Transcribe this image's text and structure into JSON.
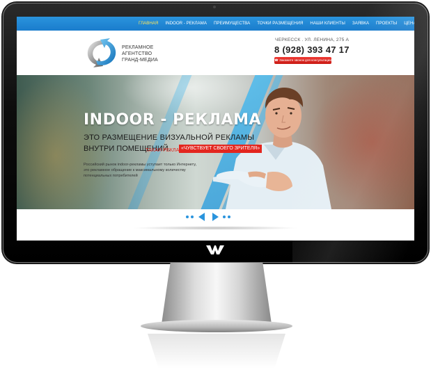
{
  "nav": {
    "items": [
      {
        "label": "ГЛАВНАЯ",
        "active": true
      },
      {
        "label": "INDOOR - РЕКЛАМА",
        "active": false
      },
      {
        "label": "ПРЕИМУЩЕСТВА",
        "active": false
      },
      {
        "label": "ТОЧКИ РАЗМЕЩЕНИЯ",
        "active": false
      },
      {
        "label": "НАШИ КЛИЕНТЫ",
        "active": false
      },
      {
        "label": "ЗАЯВКА",
        "active": false
      },
      {
        "label": "ПРОЕКТЫ",
        "active": false
      },
      {
        "label": "ЦЕНА",
        "active": false
      }
    ]
  },
  "header": {
    "logo_lines": [
      "РЕКЛАМНОЕ",
      "АГЕНТСТВО",
      "ГРАНД-МЕДИА"
    ],
    "address": "ЧЕРКЕССК . УЛ. ЛЕНИНА, 275 А",
    "phone": "8 (928) 393 47 17",
    "callback_label": "Закажите звонок для консультации"
  },
  "hero": {
    "title": "INDOOR - РЕКЛАМА",
    "line1": "ЭТО РАЗМЕЩЕНИЕ ВИЗУАЛЬНОЙ РЕКЛАМЫ",
    "line2": "ВНУТРИ ПОМЕЩЕНИЙ.",
    "such_ad": "ТАКАЯ РЕКЛАМА",
    "badge": "«ЧУВСТВУЕТ СВОЕГО ЗРИТЕЛЯ»",
    "description": "Российский рынок indoor-рекламы уступает только Интернету, это рекламное обращение к максимальному количеству потенциальных потребителей"
  },
  "colors": {
    "accent": "#1a7ccc",
    "active_nav": "#ffe65a",
    "badge": "#e3261f"
  },
  "icons": {
    "logo": "circular-arrows-icon",
    "phone": "phone-icon",
    "bezel": "brand-logo-icon"
  }
}
